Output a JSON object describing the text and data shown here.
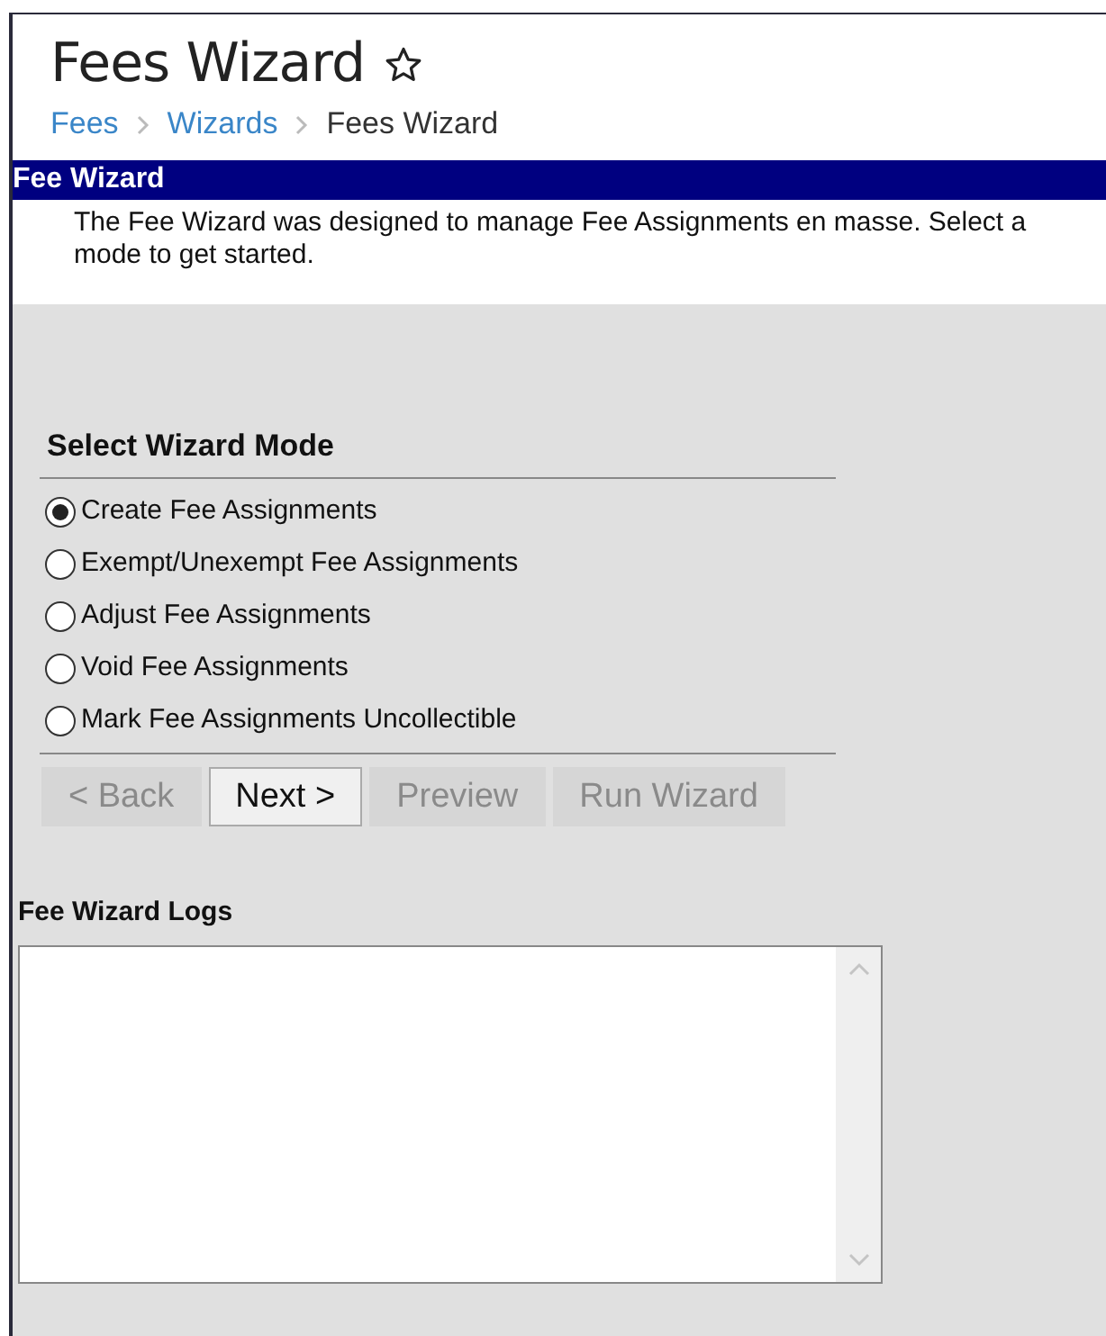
{
  "header": {
    "title": "Fees Wizard",
    "favorite": false,
    "breadcrumb": [
      {
        "label": "Fees",
        "link": true
      },
      {
        "label": "Wizards",
        "link": true
      },
      {
        "label": "Fees Wizard",
        "link": false
      }
    ]
  },
  "panel": {
    "title": "Fee Wizard",
    "description": "The Fee Wizard was designed to manage Fee Assignments en masse. Select a mode to get started."
  },
  "mode_section": {
    "title": "Select Wizard Mode",
    "modes": [
      {
        "label": "Create Fee Assignments",
        "selected": true
      },
      {
        "label": "Exempt/Unexempt Fee Assignments",
        "selected": false
      },
      {
        "label": "Adjust Fee Assignments",
        "selected": false
      },
      {
        "label": "Void Fee Assignments",
        "selected": false
      },
      {
        "label": "Mark Fee Assignments Uncollectible",
        "selected": false
      }
    ],
    "buttons": [
      {
        "label": "< Back",
        "disabled": true
      },
      {
        "label": "Next >",
        "disabled": false
      },
      {
        "label": "Preview",
        "disabled": true
      },
      {
        "label": "Run Wizard",
        "disabled": true
      }
    ]
  },
  "logs": {
    "title": "Fee Wizard Logs"
  }
}
